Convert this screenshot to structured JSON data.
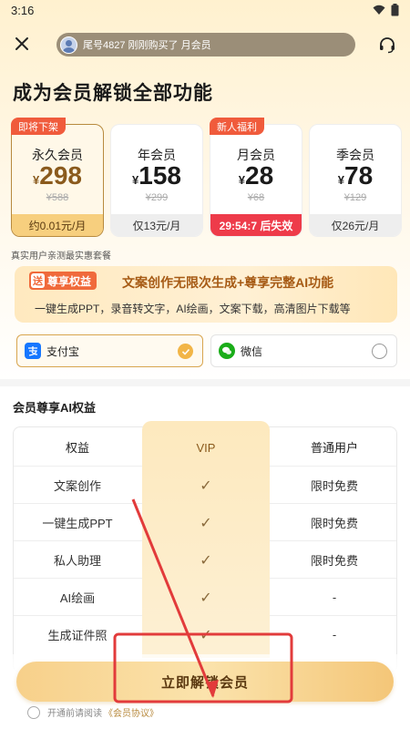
{
  "status_bar": {
    "time": "3:16"
  },
  "header": {
    "ticker_text": "尾号4827 刚刚购买了 月会员"
  },
  "page_title": "成为会员解锁全部功能",
  "plans": [
    {
      "badge": "即将下架",
      "name": "永久会员",
      "currency": "¥",
      "price": "298",
      "original": "¥588",
      "footer": "约0.01元/月",
      "selected": true
    },
    {
      "badge": "",
      "name": "年会员",
      "currency": "¥",
      "price": "158",
      "original": "¥299",
      "footer": "仅13元/月",
      "selected": false
    },
    {
      "badge": "新人福利",
      "name": "月会员",
      "currency": "¥",
      "price": "28",
      "original": "¥68",
      "footer": "29:54:7 后失效",
      "selected": false
    },
    {
      "badge": "",
      "name": "季会员",
      "currency": "¥",
      "price": "78",
      "original": "¥129",
      "footer": "仅26元/月",
      "selected": false
    }
  ],
  "disclaimer": "真实用户亲测最实惠套餐",
  "promo": {
    "badge_send": "送",
    "badge_text": "尊享权益",
    "title": "文案创作无限次生成+尊享完整AI功能",
    "subtitle": "一键生成PPT，录音转文字，AI绘画，文案下载，高清图片下载等"
  },
  "payment": {
    "options": [
      {
        "label": "支付宝",
        "icon": "alipay-icon",
        "selected": true
      },
      {
        "label": "微信",
        "icon": "wechat-icon",
        "selected": false
      }
    ]
  },
  "benefits": {
    "section_title": "会员尊享AI权益",
    "headers": [
      "权益",
      "VIP",
      "普通用户"
    ],
    "rows": [
      {
        "name": "文案创作",
        "vip": "✓",
        "normal": "限时免费"
      },
      {
        "name": "一键生成PPT",
        "vip": "✓",
        "normal": "限时免费"
      },
      {
        "name": "私人助理",
        "vip": "✓",
        "normal": "限时免费"
      },
      {
        "name": "AI绘画",
        "vip": "✓",
        "normal": "-"
      },
      {
        "name": "生成证件照",
        "vip": "✓",
        "normal": "-"
      }
    ]
  },
  "cta": {
    "button_label": "立即解锁会员",
    "agree_prefix": "开通前请阅读",
    "agree_link": "《会员协议》"
  },
  "colors": {
    "accent_gold": "#b88a3e",
    "countdown_red": "#ee3b4a",
    "badge_orange": "#f05b3c",
    "annotation_red": "#e23b3b"
  }
}
